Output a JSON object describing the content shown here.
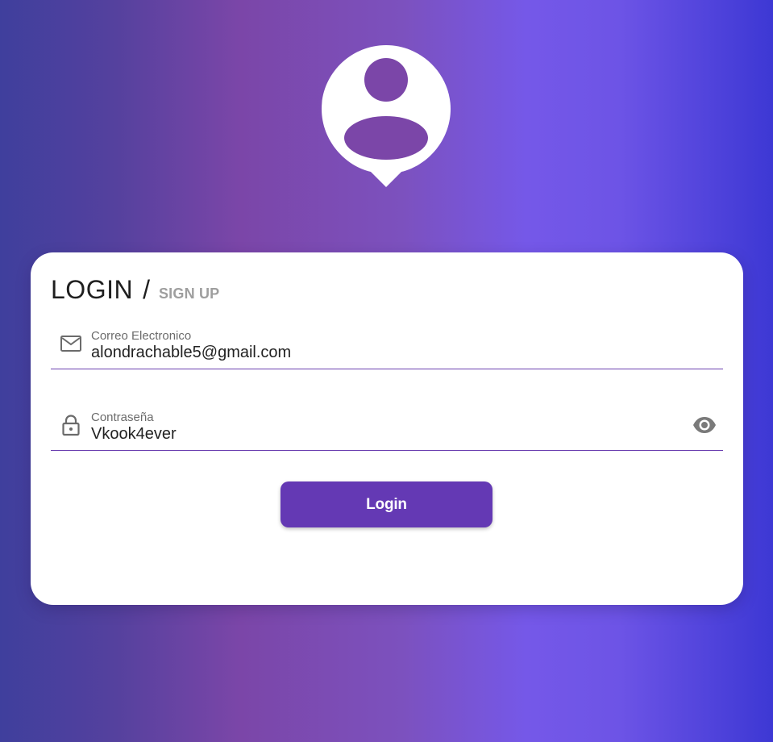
{
  "header": {
    "avatar_icon": "user-location-pin-icon"
  },
  "tabs": {
    "login_label": "LOGIN",
    "separator": "/",
    "signup_label": "SIGN UP"
  },
  "form": {
    "email": {
      "icon": "mail-icon",
      "label": "Correo Electronico",
      "value": "alondrachable5@gmail.com"
    },
    "password": {
      "icon": "lock-icon",
      "label": "Contraseña",
      "value": "Vkook4ever",
      "toggle_icon": "eye-icon"
    },
    "submit_label": "Login"
  },
  "colors": {
    "accent": "#6439b4",
    "underline": "#6a3fb0",
    "label_gray": "#6b6b6b",
    "tab_inactive": "#9e9e9e"
  }
}
